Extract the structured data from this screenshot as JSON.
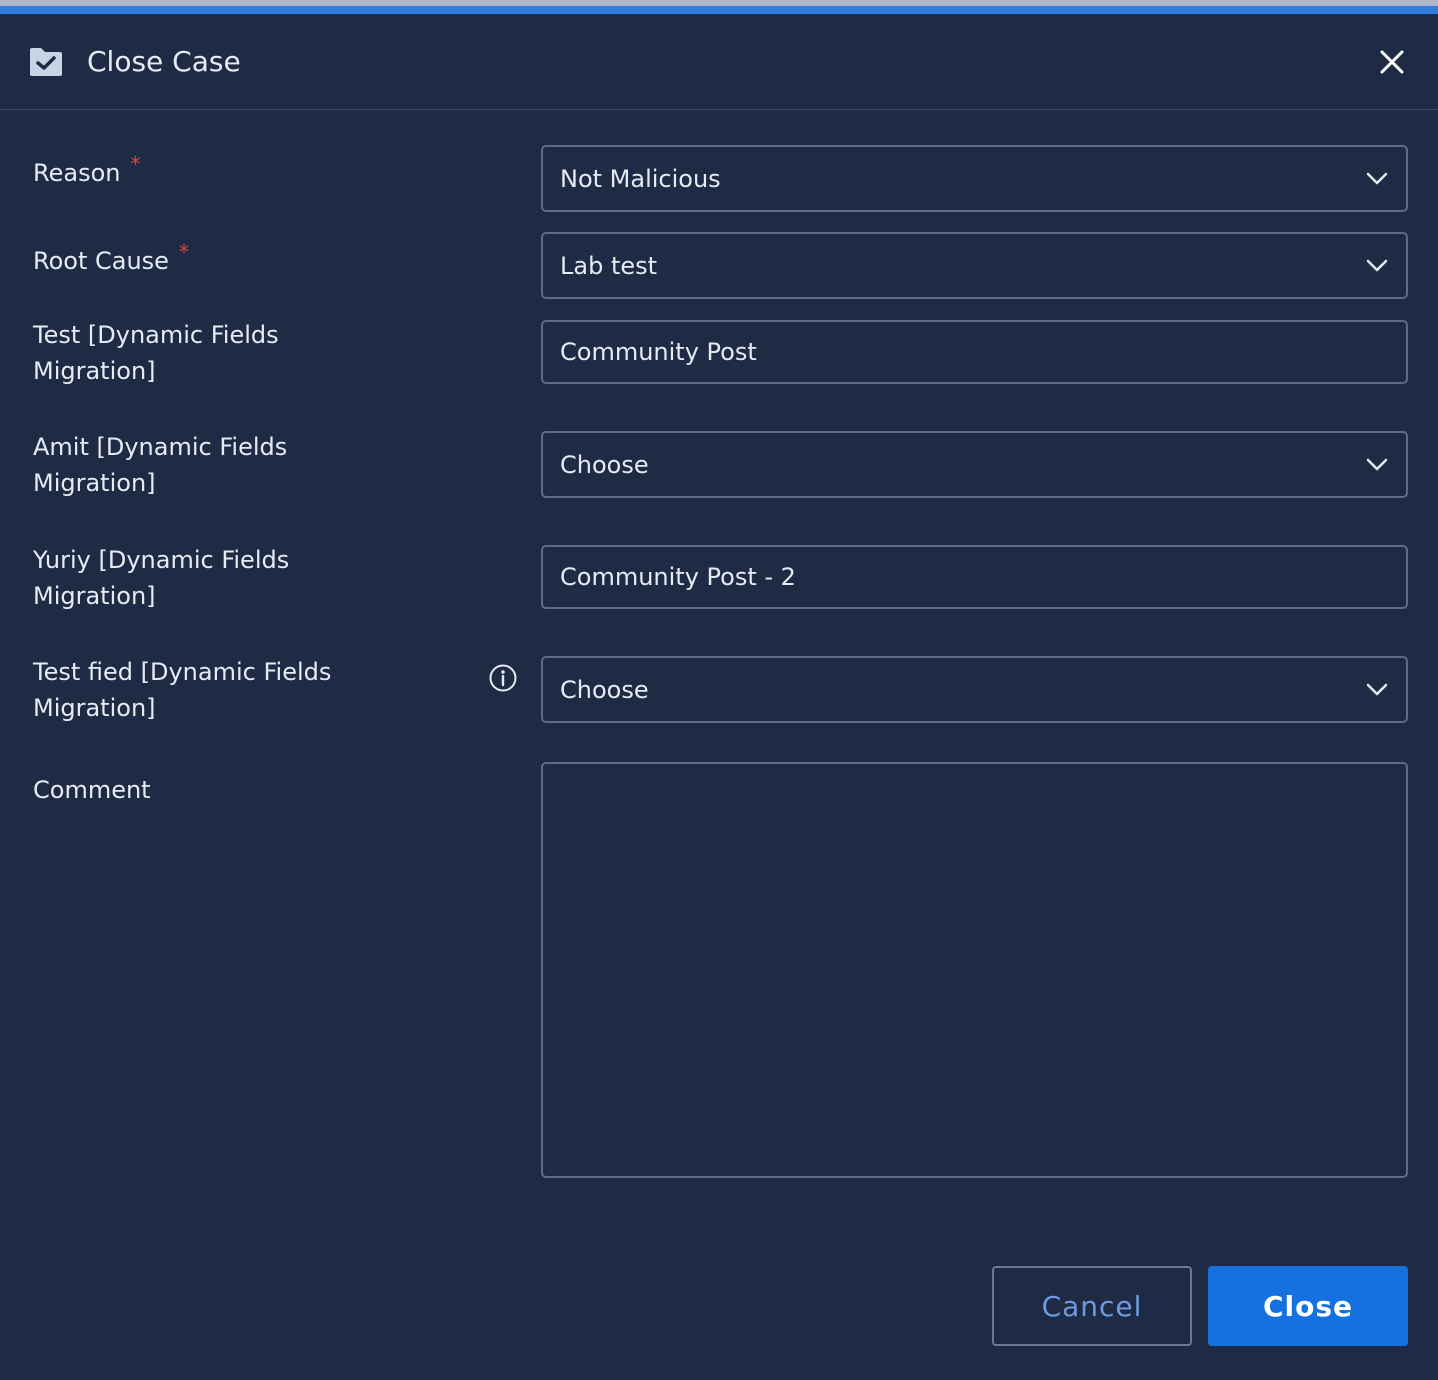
{
  "dialog": {
    "title": "Close Case",
    "title_icon": "folder-check-icon",
    "close_icon": "close-icon"
  },
  "form": {
    "reason": {
      "label": "Reason",
      "required_mark": "*",
      "value": "Not Malicious"
    },
    "root_cause": {
      "label": "Root Cause",
      "required_mark": "*",
      "value": "Lab test"
    },
    "test_dynamic": {
      "label_line1": "Test [Dynamic Fields",
      "label_line2": "Migration]",
      "value": "Community Post"
    },
    "amit_dynamic": {
      "label_line1": "Amit [Dynamic Fields",
      "label_line2": "Migration]",
      "value": "Choose"
    },
    "yuriy_dynamic": {
      "label_line1": "Yuriy [Dynamic Fields",
      "label_line2": "Migration]",
      "value": "Community Post - 2"
    },
    "test_fied_dynamic": {
      "label_line1": "Test fied [Dynamic Fields",
      "label_line2": "Migration]",
      "value": "Choose",
      "info_icon": "info-icon"
    },
    "comment": {
      "label": "Comment",
      "value": ""
    }
  },
  "actions": {
    "cancel_label": "Cancel",
    "close_label": "Close"
  },
  "colors": {
    "background": "#1f2b44",
    "accent": "#1570e0",
    "top_bar": "#2f7de1",
    "required": "#e0413a"
  }
}
